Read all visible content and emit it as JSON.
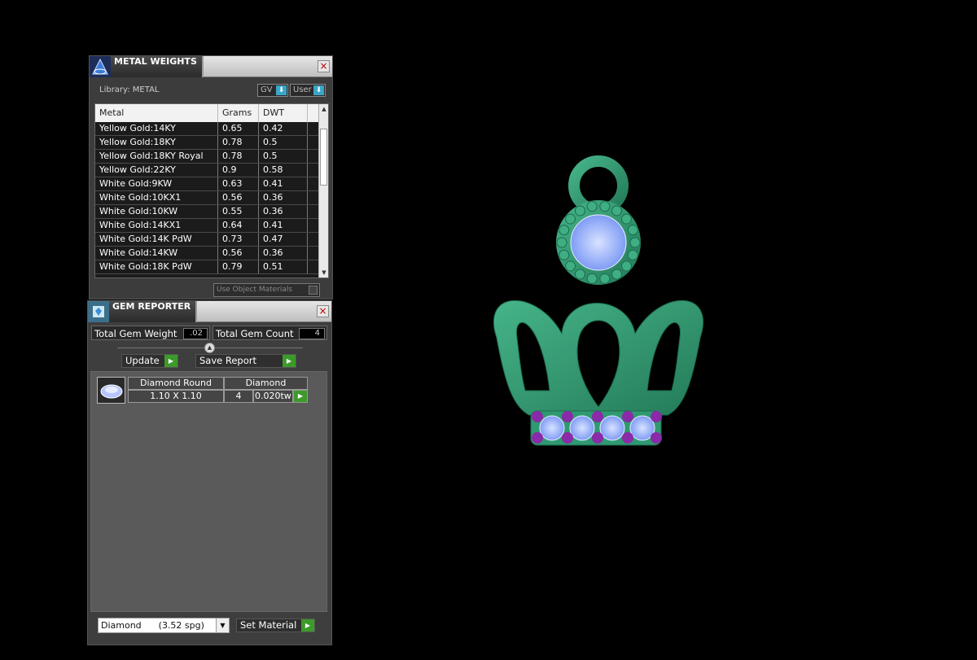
{
  "metal_weights": {
    "title": "METAL WEIGHTS",
    "close": "×",
    "library_label": "Library: METAL",
    "gv_label": "GV",
    "user_label": "User",
    "toggle_indicator": "⬇",
    "columns": [
      "Metal",
      "Grams",
      "DWT"
    ],
    "rows": [
      {
        "metal": "Yellow Gold:14KY",
        "grams": "0.65",
        "dwt": "0.42"
      },
      {
        "metal": "Yellow Gold:18KY",
        "grams": "0.78",
        "dwt": "0.5"
      },
      {
        "metal": "Yellow Gold:18KY Royal",
        "grams": "0.78",
        "dwt": "0.5"
      },
      {
        "metal": "Yellow Gold:22KY",
        "grams": "0.9",
        "dwt": "0.58"
      },
      {
        "metal": "White Gold:9KW",
        "grams": "0.63",
        "dwt": "0.41"
      },
      {
        "metal": "White Gold:10KX1",
        "grams": "0.56",
        "dwt": "0.36"
      },
      {
        "metal": "White Gold:10KW",
        "grams": "0.55",
        "dwt": "0.36"
      },
      {
        "metal": "White Gold:14KX1",
        "grams": "0.64",
        "dwt": "0.41"
      },
      {
        "metal": "White Gold:14K PdW",
        "grams": "0.73",
        "dwt": "0.47"
      },
      {
        "metal": "White Gold:14KW",
        "grams": "0.56",
        "dwt": "0.36"
      },
      {
        "metal": "White Gold:18K PdW",
        "grams": "0.79",
        "dwt": "0.51"
      }
    ],
    "use_object_materials": "Use Object Materials"
  },
  "gem_reporter": {
    "title": "GEM REPORTER",
    "close": "×",
    "total_weight_label": "Total Gem Weight",
    "total_weight_value": ".02",
    "total_count_label": "Total Gem Count",
    "total_count_value": "4",
    "update_label": "Update",
    "save_report_label": "Save Report",
    "gems": [
      {
        "shape": "Diamond Round",
        "size": "1.10 X 1.10",
        "material": "Diamond",
        "count": "4",
        "weight": "0.020tw"
      }
    ],
    "material_select": "Diamond      (3.52 spg)",
    "set_material_label": "Set Material"
  },
  "colors": {
    "metal": "#2f9a72",
    "gem_center": "#9fb8ff",
    "gem_accent": "#8a2aa8"
  }
}
